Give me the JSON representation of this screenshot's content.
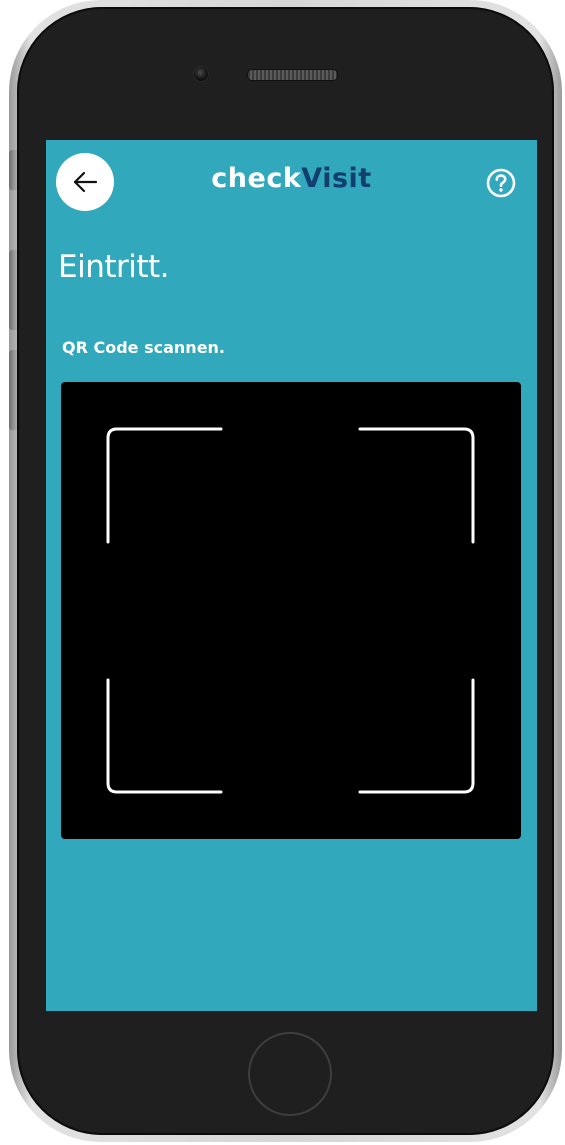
{
  "app": {
    "logo_part1": "check",
    "logo_part2": "Visit",
    "logo_colors": {
      "part1": "#ffffff",
      "part2": "#123f6e"
    },
    "background_color": "#31a8bb"
  },
  "header": {
    "back_icon": "arrow-left-icon",
    "help_icon": "question-circle-icon"
  },
  "main": {
    "title": "Eintritt.",
    "scan_label": "QR Code scannen.",
    "scanner_frame_icon": "scan-frame-corners-icon"
  },
  "device": {
    "frame": "smartphone-bezel",
    "home_button_icon": "home-button-icon"
  }
}
